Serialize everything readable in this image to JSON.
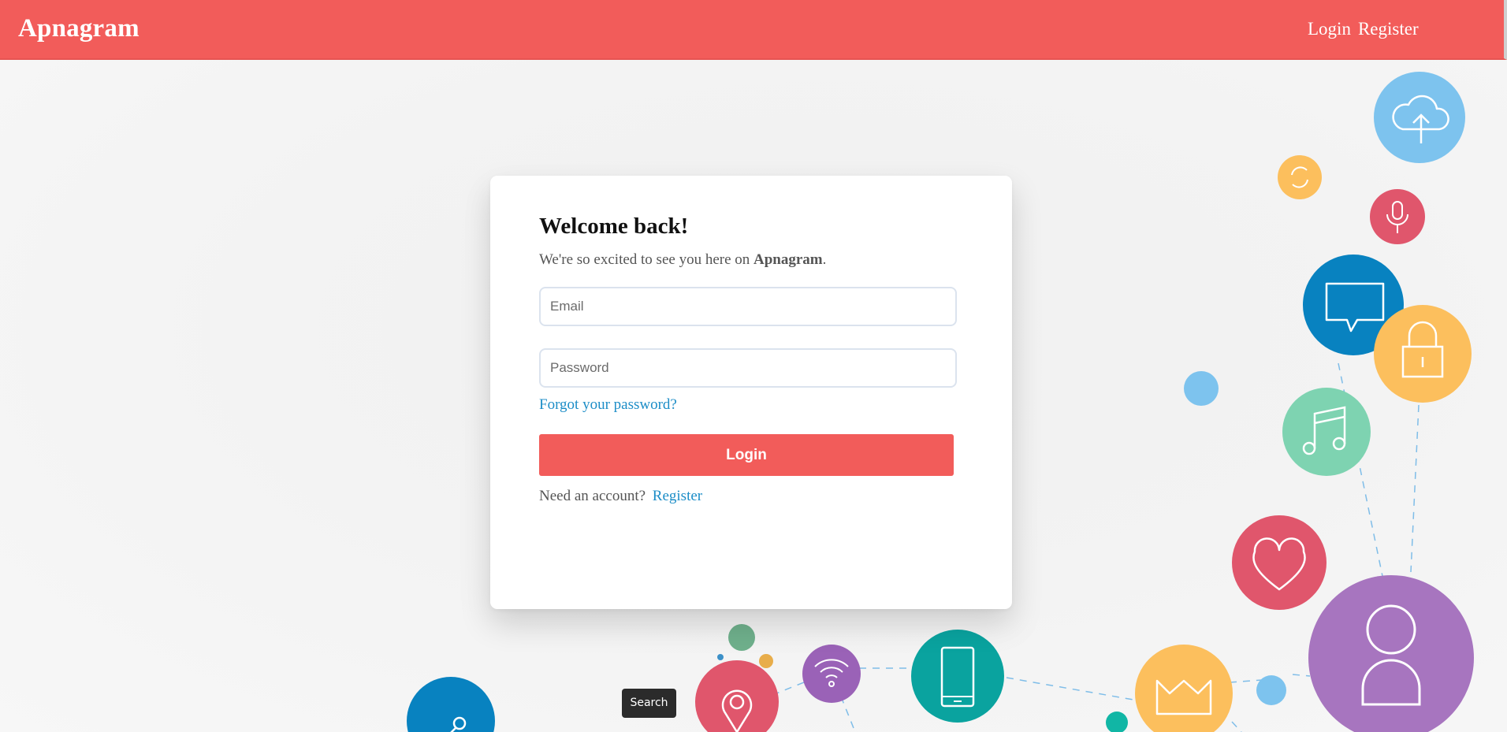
{
  "brand": "Apnagram",
  "nav": {
    "login": "Login",
    "register": "Register"
  },
  "card": {
    "title": "Welcome back!",
    "subtitle_prefix": "We're so excited to see you here on ",
    "subtitle_brand": "Apnagram",
    "subtitle_suffix": ".",
    "email_placeholder": "Email",
    "password_placeholder": "Password",
    "forgot_link": "Forgot your password?",
    "login_button": "Login",
    "need_account": "Need an account?",
    "register_link": "Register"
  },
  "tooltip": "Search",
  "colors": {
    "brand_red": "#f25c5a",
    "link_blue": "#1c8dc7"
  },
  "decor_icons": [
    "cloud-upload-icon",
    "refresh-icon",
    "microphone-icon",
    "chat-bubble-icon",
    "lock-icon",
    "music-note-icon",
    "heart-icon",
    "user-icon",
    "crown-icon",
    "mobile-phone-icon",
    "wifi-icon",
    "location-pin-icon",
    "search-icon"
  ]
}
